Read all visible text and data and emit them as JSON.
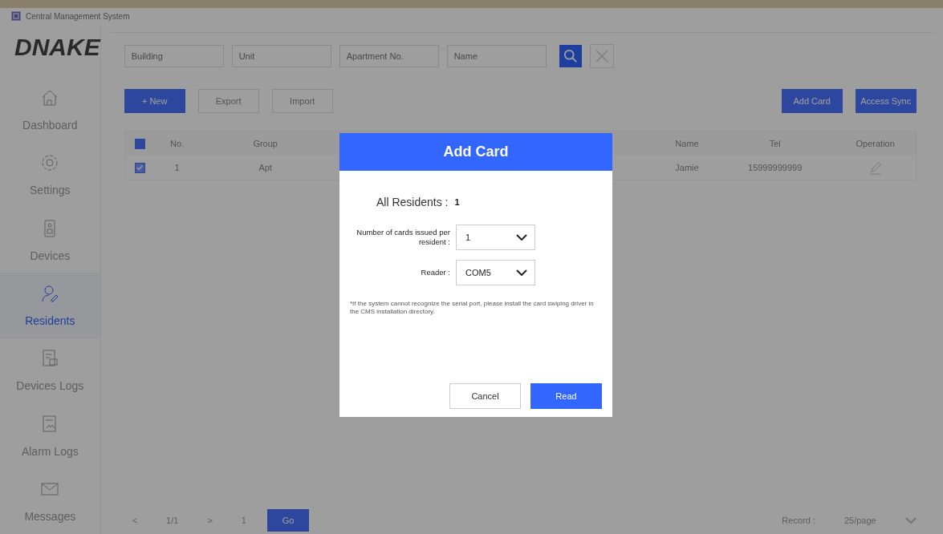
{
  "window": {
    "title": "Central Management System"
  },
  "logo": {
    "text": "DNAKE"
  },
  "sidebar": {
    "items": [
      {
        "label": "Dashboard",
        "selected": false
      },
      {
        "label": "Settings",
        "selected": false
      },
      {
        "label": "Devices",
        "selected": false
      },
      {
        "label": "Residents",
        "selected": true
      },
      {
        "label": "Devices Logs",
        "selected": false
      },
      {
        "label": "Alarm Logs",
        "selected": false
      },
      {
        "label": "Messages",
        "selected": false
      }
    ]
  },
  "search": {
    "fields": [
      {
        "placeholder": "Building"
      },
      {
        "placeholder": "Unit"
      },
      {
        "placeholder": "Apartment No."
      },
      {
        "placeholder": "Name"
      }
    ]
  },
  "toolbar": {
    "left": [
      {
        "label": "+ New",
        "kind": "primary"
      },
      {
        "label": "Export",
        "kind": "outline"
      },
      {
        "label": "Import",
        "kind": "outline"
      }
    ],
    "right": [
      {
        "label": "Add Card",
        "kind": "primary"
      },
      {
        "label": "Access Sync",
        "kind": "primary"
      }
    ]
  },
  "table": {
    "all_checked": true,
    "columns": [
      "No.",
      "Group",
      "Name",
      "Tel",
      "Operation"
    ],
    "rows": [
      {
        "checked": true,
        "cells": [
          "1",
          "Apt",
          "Jamie",
          "15999999999"
        ]
      }
    ]
  },
  "pagination": {
    "prev": "<",
    "pages": "1/1",
    "next": ">",
    "page": "1",
    "go": "Go",
    "record_label": "Record :",
    "page_size": "25/page"
  },
  "dialog": {
    "title": "Add Card",
    "summary_label": "All Residents :",
    "summary_value": "1",
    "fields": [
      {
        "label": "Number of cards issued per resident :",
        "value": "1"
      },
      {
        "label": "Reader :",
        "value": "COM5"
      }
    ],
    "note": "*If the system cannot recognize the serial port, please install the card swiping driver in the CMS installation directory.",
    "buttons": [
      {
        "label": "Cancel",
        "kind": "secondary"
      },
      {
        "label": "Read",
        "kind": "primary"
      }
    ]
  }
}
